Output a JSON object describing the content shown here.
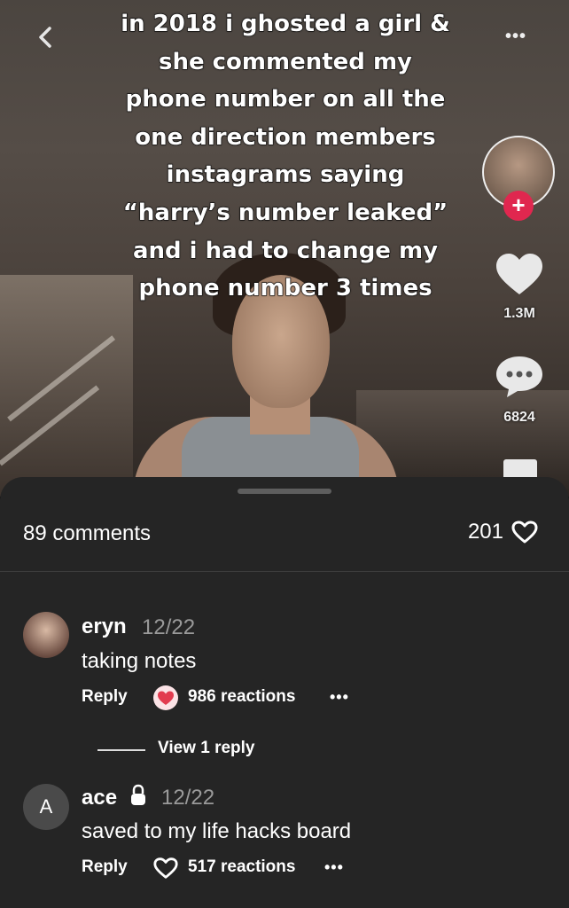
{
  "video": {
    "caption": "in 2018 i ghosted a girl &\nshe commented my\nphone number on all the\none direction members\ninstagrams saying\n“harry’s number leaked”\nand i had to change my\nphone number 3 times",
    "like_count": "1.3M",
    "comment_count": "6824",
    "more_label": "•••",
    "follow_label": "+",
    "icons": [
      "back-chevron-icon",
      "heart-icon",
      "comment-bubble-icon",
      "bookmark-icon"
    ]
  },
  "sheet": {
    "comments_count_label": "89 comments",
    "likes_count": "201"
  },
  "comments": [
    {
      "author": "eryn",
      "date": "12/22",
      "text": "taking notes",
      "reply_label": "Reply",
      "reactions": "986 reactions",
      "more": "•••",
      "view_replies": "View 1 reply"
    },
    {
      "author": "ace",
      "avatar_letter": "A",
      "date": "12/22",
      "text": "saved to my life hacks board",
      "reply_label": "Reply",
      "reactions": "517 reactions",
      "more": "•••"
    }
  ],
  "colors": {
    "sheet_bg": "#252525",
    "follow_red": "#e0274f",
    "muted_text": "#9a9a9a"
  }
}
